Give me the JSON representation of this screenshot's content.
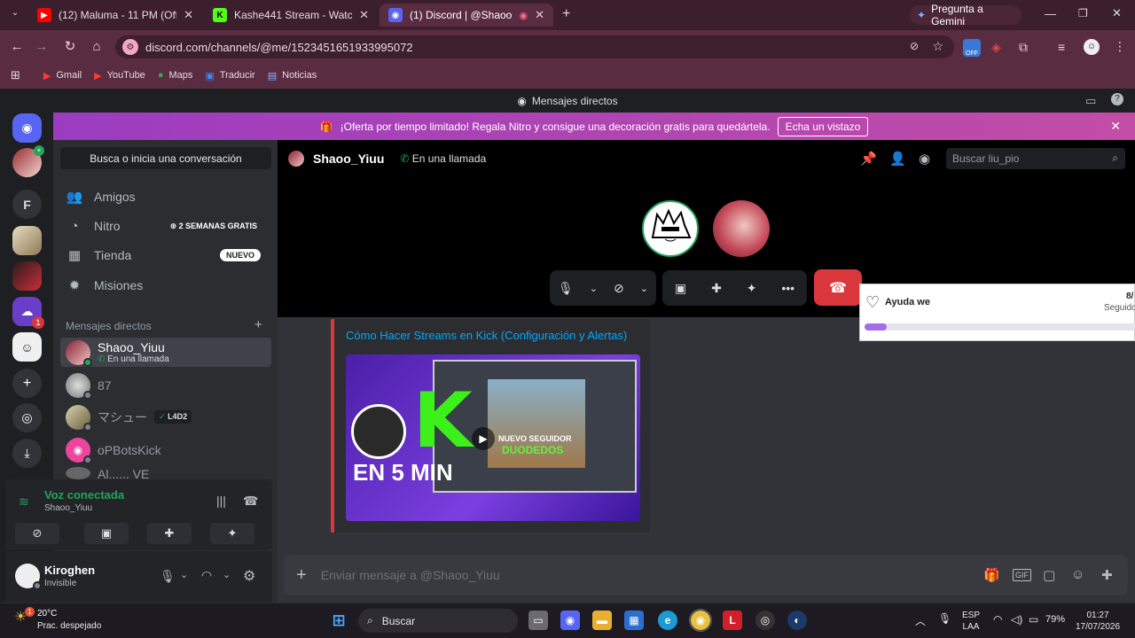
{
  "browser": {
    "tabs": [
      {
        "title": "(12) Maluma - 11 PM (Official V",
        "favicon": "youtube-icon",
        "active": false
      },
      {
        "title": "Kashe441 Stream - Watch Live c",
        "favicon": "kick-icon",
        "active": false
      },
      {
        "title": "(1) Discord | @Shaoo_Yiuu",
        "favicon": "discord-icon",
        "active": true
      }
    ],
    "gemini_label": "Pregunta a Gemini",
    "url": "discord.com/channels/@me/1523451651933995072",
    "bookmarks": [
      "Gmail",
      "YouTube",
      "Maps",
      "Traducir",
      "Noticias"
    ],
    "extension_badge": "OFF"
  },
  "discord": {
    "window_title": "Mensajes directos",
    "guild_letter": "F",
    "guild_badge": "1",
    "banner_text": "¡Oferta por tiempo limitado! Regala Nitro y consigue una decoración gratis para quedártela.",
    "banner_button": "Echa un vistazo",
    "search_conversation": "Busca o inicia una conversación",
    "nav": [
      {
        "label": "Amigos",
        "badge": "",
        "icon": "friends-icon"
      },
      {
        "label": "Nitro",
        "badge": "2 SEMANAS GRATIS",
        "icon": "nitro-icon"
      },
      {
        "label": "Tienda",
        "badge": "NUEVO",
        "icon": "shop-icon"
      },
      {
        "label": "Misiones",
        "badge": "",
        "icon": "quests-icon"
      }
    ],
    "dm_header": "Mensajes directos",
    "dms": [
      {
        "name": "Shaoo_Yiuu",
        "sub": "En una llamada",
        "badge": ""
      },
      {
        "name": "87",
        "sub": "",
        "badge": ""
      },
      {
        "name": "マシュー",
        "sub": "",
        "badge": "L4D2"
      },
      {
        "name": "oPBotsKick",
        "sub": "",
        "badge": ""
      },
      {
        "name": "Al...... VE",
        "sub": "",
        "badge": ""
      }
    ],
    "voice": {
      "status": "Voz conectada",
      "channel": "Shaoo_Yiuu"
    },
    "user": {
      "name": "Kiroghen",
      "status": "Invisible"
    },
    "channel": {
      "name": "Shaoo_Yiuu",
      "call_status": "En una llamada",
      "search_placeholder": "Buscar liu_pio"
    },
    "embed": {
      "title": "Cómo Hacer Streams en Kick (Configuración y Alertas)",
      "thumb_big": "K",
      "thumb_sub": "EN 5 MIN",
      "thumb_overlay": "NUEVO SEGUIDOR",
      "thumb_overlay2": "DUODEDOS"
    },
    "composer_placeholder": "Enviar mensaje a @Shaoo_Yiuu"
  },
  "widget": {
    "title": "Ayuda we",
    "count": "8/",
    "sub": "Seguido",
    "progress": 0.08
  },
  "taskbar": {
    "weather_temp": "20°C",
    "weather_desc": "Prac. despejado",
    "weather_badge": "1",
    "search": "Buscar",
    "lang1": "ESP",
    "lang2": "LAA",
    "battery": "79%",
    "time": "01:27",
    "date": "17/07/2026"
  },
  "colors": {
    "accent": "#5865f2",
    "danger": "#da373c",
    "online": "#23a55a",
    "link": "#00a8fc"
  }
}
